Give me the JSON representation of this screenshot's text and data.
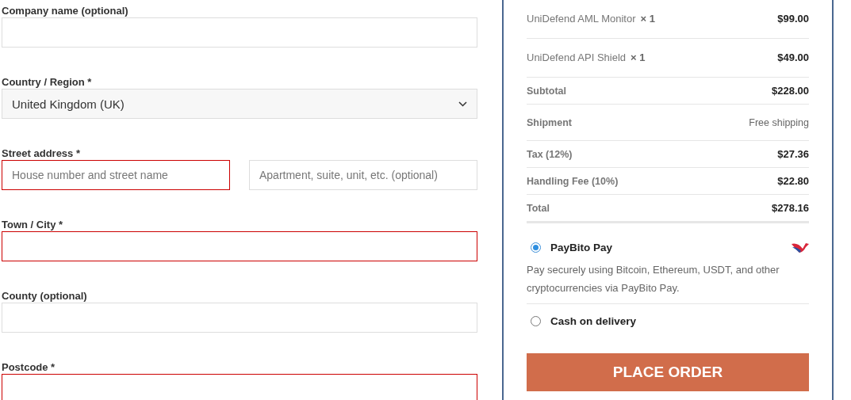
{
  "billing_fields": [
    {
      "kind": "text",
      "label": "Company name (optional)",
      "invalid": false
    },
    {
      "kind": "select",
      "label": "Country / Region *",
      "value": "United Kingdom (UK)"
    },
    {
      "kind": "pair",
      "label": "Street address *",
      "inputs": [
        {
          "placeholder": "House number and street name",
          "invalid": true
        },
        {
          "placeholder": "Apartment, suite, unit, etc. (optional)",
          "invalid": false
        }
      ]
    },
    {
      "kind": "text",
      "label": "Town / City *",
      "invalid": true
    },
    {
      "kind": "text",
      "label": "County (optional)",
      "invalid": false
    },
    {
      "kind": "text",
      "label": "Postcode *",
      "invalid": true
    }
  ],
  "order_summary": {
    "items": [
      {
        "name": "UniDefend AML Monitor",
        "quantity": "× 1",
        "price": "$99.00"
      },
      {
        "name": "UniDefend API Shield",
        "quantity": "× 1",
        "price": "$49.00"
      }
    ],
    "totals": [
      {
        "kind": "amount",
        "label": "Subtotal",
        "value": "$228.00"
      },
      {
        "kind": "note",
        "label": "Shipment",
        "value": "Free shipping"
      },
      {
        "kind": "amount",
        "label": "Tax (12%)",
        "value": "$27.36"
      },
      {
        "kind": "amount",
        "label": "Handling Fee (10%)",
        "value": "$22.80"
      },
      {
        "kind": "amount",
        "label": "Total",
        "value": "$278.16"
      }
    ]
  },
  "payment_methods": [
    {
      "label": "PayBito Pay",
      "selected": true,
      "has_logo": true,
      "description": "Pay securely using Bitcoin, Ethereum, USDT, and other cryptocurrencies via PayBito Pay."
    },
    {
      "label": "Cash on delivery",
      "selected": false,
      "has_logo": false
    }
  ],
  "place_order_button": {
    "label": "PLACE ORDER"
  }
}
